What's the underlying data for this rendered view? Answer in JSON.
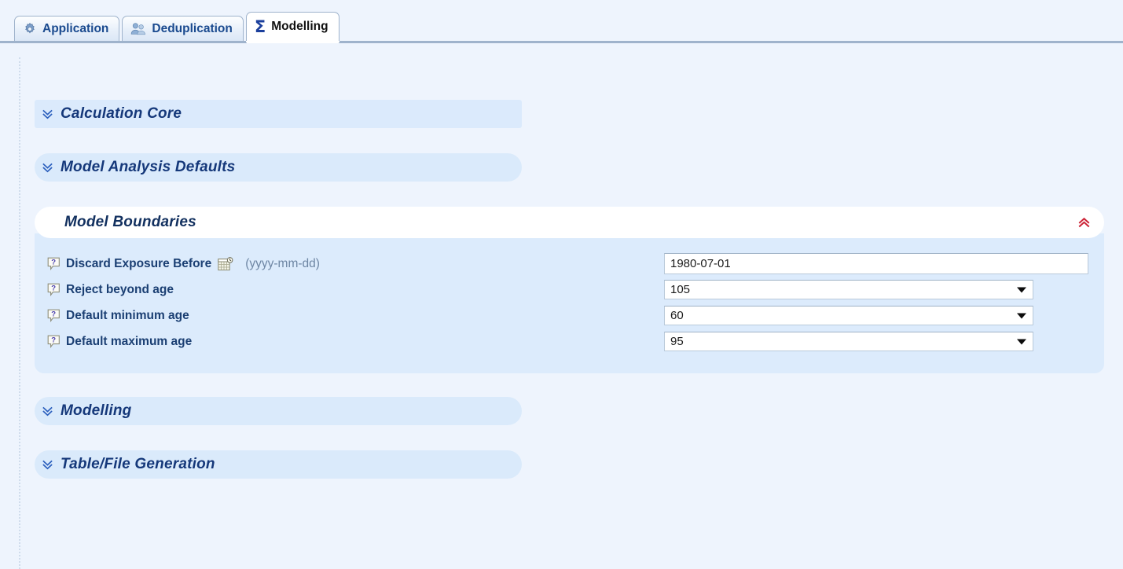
{
  "tabs": [
    {
      "label": "Application",
      "icon": "gear-icon",
      "active": false
    },
    {
      "label": "Deduplication",
      "icon": "people-icon",
      "active": false
    },
    {
      "label": "Modelling",
      "icon": "sigma-icon",
      "active": true
    }
  ],
  "sections": {
    "calculation_core": {
      "title": "Calculation Core",
      "state": "collapsed",
      "expand_icon": "double-chevron-down-icon"
    },
    "model_analysis": {
      "title": "Model Analysis Defaults",
      "state": "collapsed",
      "expand_icon": "double-chevron-down-icon"
    },
    "model_boundaries": {
      "title": "Model Boundaries",
      "state": "expanded",
      "collapse_icon": "double-chevron-up-icon"
    },
    "modelling": {
      "title": "Modelling",
      "state": "collapsed",
      "expand_icon": "double-chevron-down-icon"
    },
    "table_file_generation": {
      "title": "Table/File Generation",
      "state": "collapsed",
      "expand_icon": "double-chevron-down-icon"
    }
  },
  "model_boundaries_fields": {
    "discard_exposure": {
      "help_icon": "help-question-icon",
      "label": "Discard Exposure Before",
      "date_icon": "calendar-icon",
      "hint": "(yyyy-mm-dd)",
      "value": "1980-07-01",
      "placeholder": "yyyy-mm-dd",
      "control": "text"
    },
    "reject_beyond_age": {
      "help_icon": "help-question-icon",
      "label": "Reject beyond age",
      "value": "105",
      "control": "select"
    },
    "default_minimum_age": {
      "help_icon": "help-question-icon",
      "label": "Default minimum age",
      "value": "60",
      "control": "select"
    },
    "default_maximum_age": {
      "help_icon": "help-question-icon",
      "label": "Default maximum age",
      "value": "95",
      "control": "select"
    }
  },
  "colors": {
    "page_background": "#eef4fd",
    "panel_background": "#dcebfc",
    "section_bar": "#daeafb",
    "label_text": "#1b3f73",
    "title_text": "#15387a",
    "hint_text": "#6e86a4",
    "expand_chevron": "#2b5fbd",
    "collapse_chevron": "#cc2336",
    "active_tab_background": "#ffffff",
    "tab_border": "#9fb3cc"
  }
}
